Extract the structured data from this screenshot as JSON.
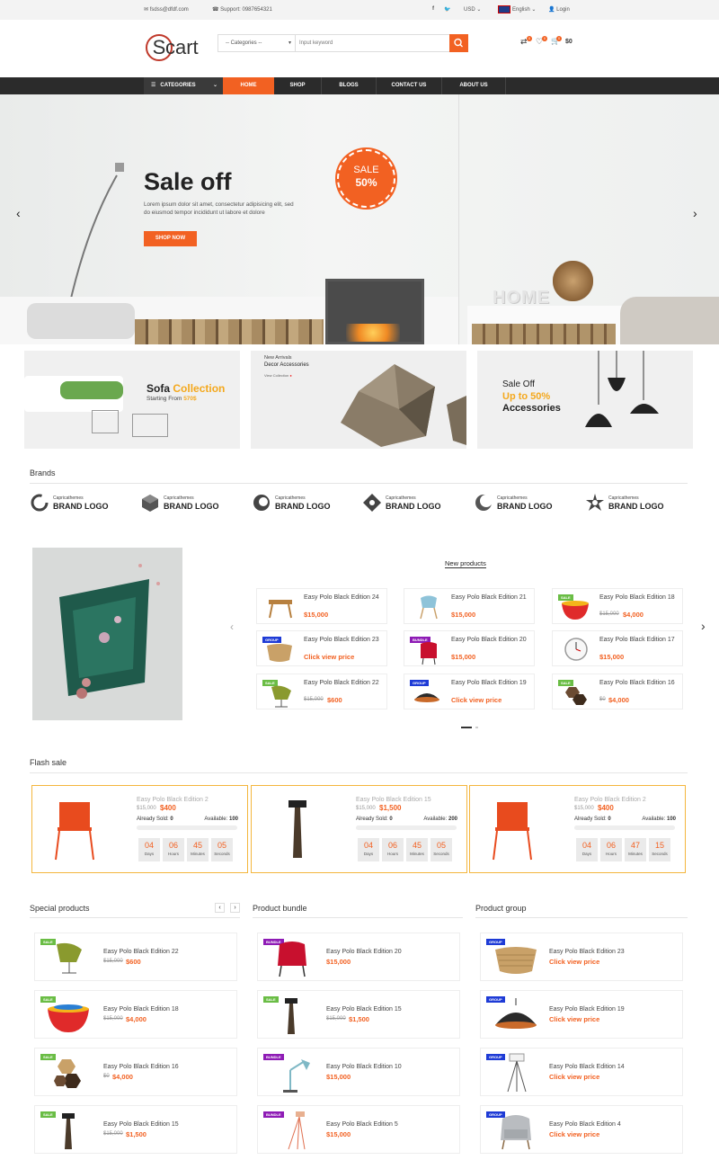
{
  "topbar": {
    "email": "fsdss@dfdf.com",
    "support": "Support: 0987654321",
    "currency": "USD",
    "language": "English",
    "login": "Login"
  },
  "header": {
    "logo_s": "S",
    "logo_rest": "cart",
    "category_select": "-- Categories --",
    "search_placeholder": "Input keyword",
    "cart_total": "$0",
    "compare_count": "0",
    "wishlist_count": "0",
    "cart_count": "0"
  },
  "nav": {
    "categories": "CATEGORIES",
    "items": [
      "HOME",
      "SHOP",
      "BLOGS",
      "CONTACT US",
      "ABOUT US"
    ]
  },
  "hero": {
    "title": "Sale off",
    "text_line1": "Lorem ipsum dolor sit amet, consectetur adipisicing elit, sed",
    "text_line2": "do eiusmod tempor incididunt ut labore et dolore",
    "button": "SHOP NOW",
    "badge_line1": "SALE",
    "badge_line2": "50%",
    "wall_text": "HOME"
  },
  "banners": {
    "sofa": {
      "word1": "Sofa",
      "word2": "Collection",
      "starting": "Starting From",
      "price": "570$"
    },
    "decor": {
      "line1": "New Arrivals",
      "line2": "Decor Accessories",
      "link": "View Collection"
    },
    "lamp": {
      "line1": "Sale Off",
      "line2": "Up to 50%",
      "line3": "Accessories"
    }
  },
  "brands": {
    "title": "Brands",
    "items": [
      {
        "top": "Capricathemes",
        "name": "BRAND LOGO"
      },
      {
        "top": "Capricathemes",
        "name": "BRAND LOGO"
      },
      {
        "top": "Capricathemes",
        "name": "BRAND LOGO"
      },
      {
        "top": "Capricathemes",
        "name": "BRAND LOGO"
      },
      {
        "top": "Capricathemes",
        "name": "BRAND LOGO"
      },
      {
        "top": "Capricathemes",
        "name": "BRAND LOGO"
      }
    ]
  },
  "new_products": {
    "title": "New products",
    "items": [
      {
        "name": "Easy Polo Black Edition 24",
        "price": "$15,000",
        "old": "",
        "badge": ""
      },
      {
        "name": "Easy Polo Black Edition 21",
        "price": "$15,000",
        "old": "",
        "badge": ""
      },
      {
        "name": "Easy Polo Black Edition 18",
        "price": "$4,000",
        "old": "$15,000",
        "badge": "SALE"
      },
      {
        "name": "Easy Polo Black Edition 23",
        "price": "Click view price",
        "old": "",
        "badge": "GROUP"
      },
      {
        "name": "Easy Polo Black Edition 20",
        "price": "$15,000",
        "old": "",
        "badge": "BUNDLE"
      },
      {
        "name": "Easy Polo Black Edition 17",
        "price": "$15,000",
        "old": "",
        "badge": ""
      },
      {
        "name": "Easy Polo Black Edition 22",
        "price": "$600",
        "old": "$15,000",
        "badge": "SALE"
      },
      {
        "name": "Easy Polo Black Edition 19",
        "price": "Click view price",
        "old": "",
        "badge": "GROUP"
      },
      {
        "name": "Easy Polo Black Edition 16",
        "price": "$4,000",
        "old": "$0",
        "badge": "SALE"
      }
    ]
  },
  "flash_sale": {
    "title": "Flash sale",
    "sold_label": "Already Sold:",
    "available_label": "Available:",
    "units": [
      "Days",
      "Hours",
      "Minutes",
      "Seconds"
    ],
    "items": [
      {
        "name": "Easy Polo Black Edition 2",
        "old": "$15,000",
        "price": "$400",
        "sold": "0",
        "available": "100",
        "countdown": [
          "04",
          "06",
          "45",
          "05"
        ]
      },
      {
        "name": "Easy Polo Black Edition 15",
        "old": "$15,000",
        "price": "$1,500",
        "sold": "0",
        "available": "200",
        "countdown": [
          "04",
          "06",
          "45",
          "05"
        ]
      },
      {
        "name": "Easy Polo Black Edition 2",
        "old": "$15,000",
        "price": "$400",
        "sold": "0",
        "available": "100",
        "countdown": [
          "04",
          "06",
          "47",
          "15"
        ]
      }
    ]
  },
  "special": {
    "title": "Special products",
    "items": [
      {
        "name": "Easy Polo Black Edition 22",
        "old": "$15,000",
        "price": "$600",
        "badge": "SALE"
      },
      {
        "name": "Easy Polo Black Edition 18",
        "old": "$15,000",
        "price": "$4,000",
        "badge": "SALE"
      },
      {
        "name": "Easy Polo Black Edition 16",
        "old": "$0",
        "price": "$4,000",
        "badge": "SALE"
      },
      {
        "name": "Easy Polo Black Edition 15",
        "old": "$15,000",
        "price": "$1,500",
        "badge": "SALE"
      }
    ]
  },
  "bundle": {
    "title": "Product bundle",
    "items": [
      {
        "name": "Easy Polo Black Edition 20",
        "old": "",
        "price": "$15,000",
        "badge": "BUNDLE"
      },
      {
        "name": "Easy Polo Black Edition 15",
        "old": "$15,000",
        "price": "$1,500",
        "badge": "SALE"
      },
      {
        "name": "Easy Polo Black Edition 10",
        "old": "",
        "price": "$15,000",
        "badge": "BUNDLE"
      },
      {
        "name": "Easy Polo Black Edition 5",
        "old": "",
        "price": "$15,000",
        "badge": "BUNDLE"
      }
    ]
  },
  "group": {
    "title": "Product group",
    "items": [
      {
        "name": "Easy Polo Black Edition 23",
        "old": "",
        "price": "Click view price",
        "badge": "GROUP"
      },
      {
        "name": "Easy Polo Black Edition 19",
        "old": "",
        "price": "Click view price",
        "badge": "GROUP"
      },
      {
        "name": "Easy Polo Black Edition 14",
        "old": "",
        "price": "Click view price",
        "badge": "GROUP"
      },
      {
        "name": "Easy Polo Black Edition 4",
        "old": "",
        "price": "Click view price",
        "badge": "GROUP"
      }
    ]
  },
  "colors": {
    "accent": "#f26122",
    "nav_bg": "#2b2b2b",
    "sale_badge": "#6abd45",
    "group_badge": "#1e3bd6",
    "bundle_badge": "#8e1bb5",
    "flash_border": "#f4b63d"
  }
}
